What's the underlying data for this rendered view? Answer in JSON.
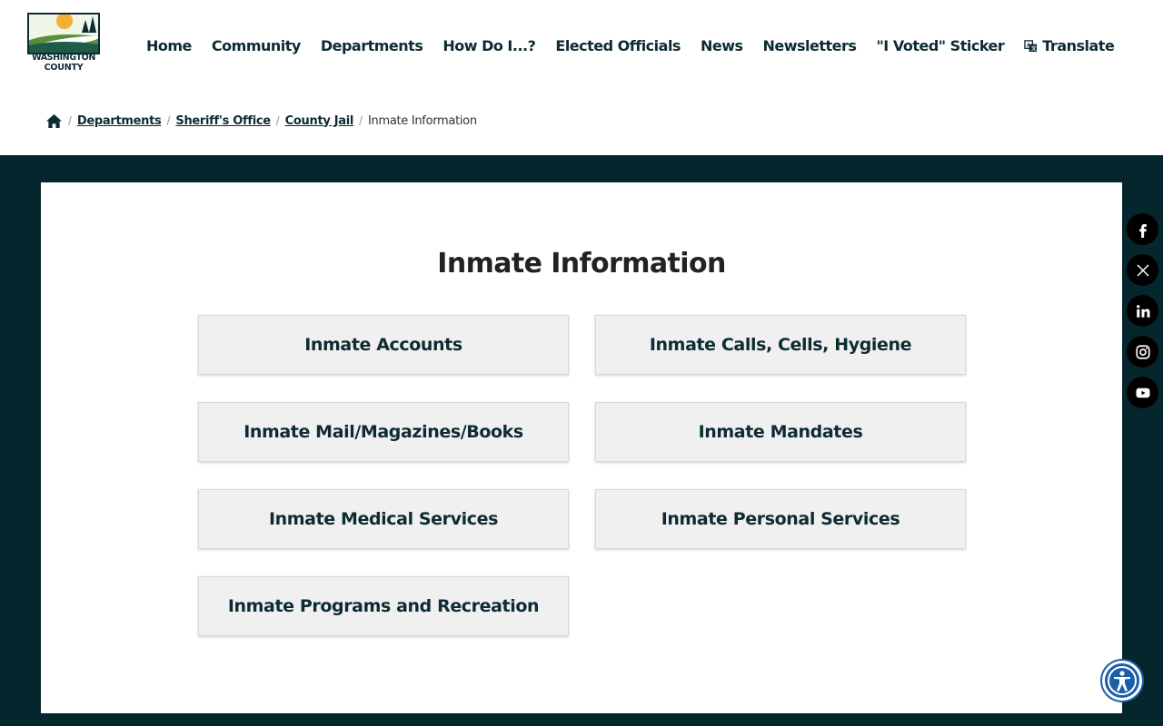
{
  "logo": {
    "line1": "WASHINGTON",
    "line2": "COUNTY"
  },
  "nav": {
    "items": [
      "Home",
      "Community",
      "Departments",
      "How Do I...?",
      "Elected Officials",
      "News",
      "Newsletters",
      "\"I Voted\" Sticker"
    ],
    "translate": "Translate"
  },
  "breadcrumb": {
    "links": [
      "Departments",
      "Sheriff's Office",
      "County Jail"
    ],
    "current": "Inmate Information"
  },
  "page": {
    "title": "Inmate Information",
    "tiles": [
      "Inmate Accounts",
      "Inmate Calls, Cells, Hygiene",
      "Inmate Mail/Magazines/Books",
      "Inmate Mandates",
      "Inmate Medical Services",
      "Inmate Personal Services",
      "Inmate Programs and Recreation"
    ]
  },
  "social": {
    "icons": [
      "facebook-icon",
      "x-icon",
      "linkedin-icon",
      "instagram-icon",
      "youtube-icon"
    ]
  },
  "colors": {
    "band": "#06262e",
    "nav_text": "#0d2b33",
    "tile_bg": "#f0f0f0",
    "accessibility": "#1b5fa8"
  }
}
